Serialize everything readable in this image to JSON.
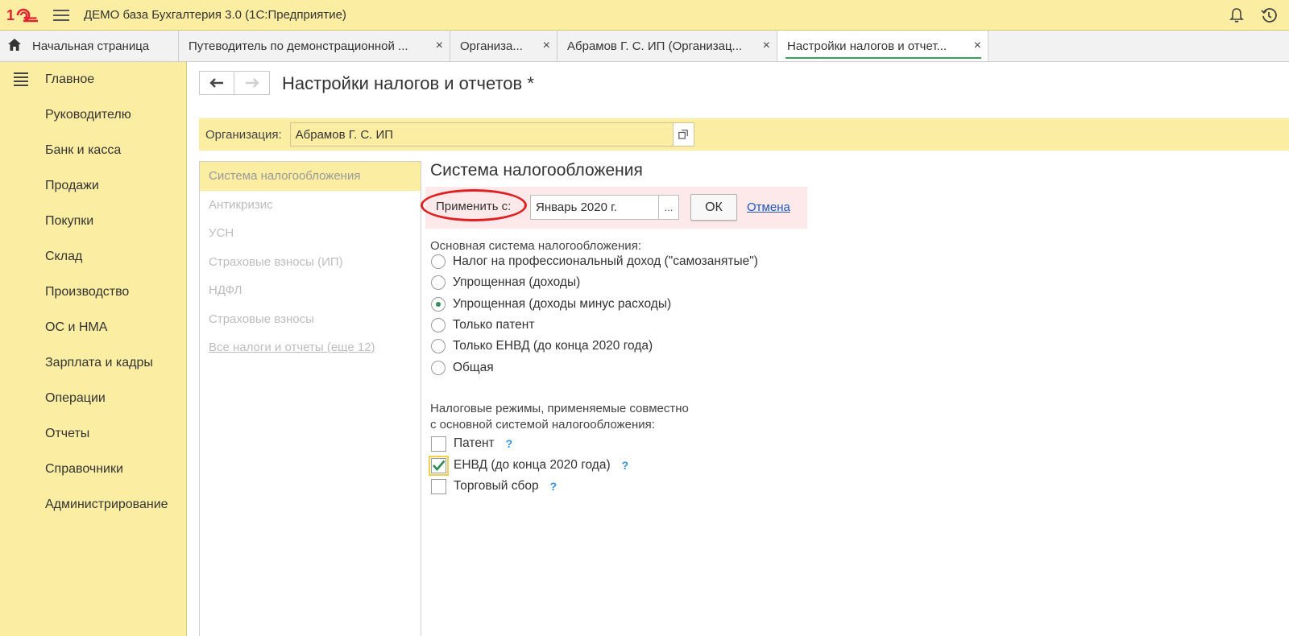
{
  "app": {
    "title": "ДЕМО база Бухгалтерия 3.0  (1С:Предприятие)",
    "logo_text": "1С",
    "brand_color": "#e5202e",
    "accent": "#fbeda2"
  },
  "tabs": [
    {
      "label": "Начальная страница",
      "closable": false
    },
    {
      "label": "Путеводитель по демонстрационной ...",
      "closable": true
    },
    {
      "label": "Организа...",
      "closable": true
    },
    {
      "label": "Абрамов Г. С. ИП (Организац...",
      "closable": true
    },
    {
      "label": "Настройки налогов и отчет...",
      "closable": true,
      "active": true
    }
  ],
  "tab_close_glyph": "×",
  "sidebar": {
    "items": [
      {
        "label": "Главное"
      },
      {
        "label": "Руководителю"
      },
      {
        "label": "Банк и касса"
      },
      {
        "label": "Продажи"
      },
      {
        "label": "Покупки"
      },
      {
        "label": "Склад"
      },
      {
        "label": "Производство"
      },
      {
        "label": "ОС и НМА"
      },
      {
        "label": "Зарплата и кадры"
      },
      {
        "label": "Операции"
      },
      {
        "label": "Отчеты"
      },
      {
        "label": "Справочники"
      },
      {
        "label": "Администрирование"
      }
    ]
  },
  "page": {
    "title": "Настройки налогов и отчетов *",
    "org_label": "Организация:",
    "org_value": "Абрамов Г. С. ИП"
  },
  "leftnav": [
    {
      "label": "Система налогообложения",
      "active": true
    },
    {
      "label": "Антикризис"
    },
    {
      "label": "УСН"
    },
    {
      "label": "Страховые взносы (ИП)"
    },
    {
      "label": "НДФЛ"
    },
    {
      "label": "Страховые взносы"
    },
    {
      "label": "Все налоги и отчеты (еще 12)",
      "link": true
    }
  ],
  "section": {
    "title": "Система налогообложения",
    "apply_label": "Применить с:",
    "apply_date": "Январь 2020 г.",
    "date_button": "...",
    "ok_label": "ОК",
    "cancel_label": "Отмена",
    "main_system_label": "Основная система налогообложения:",
    "radio_options": [
      {
        "label": "Налог на профессиональный доход (\"самозанятые\")",
        "selected": false
      },
      {
        "label": "Упрощенная (доходы)",
        "selected": false
      },
      {
        "label": "Упрощенная (доходы минус расходы)",
        "selected": true
      },
      {
        "label": "Только патент",
        "selected": false
      },
      {
        "label": "Только ЕНВД (до конца 2020 года)",
        "selected": false
      },
      {
        "label": "Общая",
        "selected": false
      }
    ],
    "regimes_label_line1": "Налоговые режимы, применяемые совместно",
    "regimes_label_line2": "с основной системой налогообложения:",
    "checkboxes": [
      {
        "label": "Патент",
        "checked": false,
        "help": "?"
      },
      {
        "label": "ЕНВД (до конца 2020 года)",
        "checked": true,
        "help": "?"
      },
      {
        "label": "Торговый сбор",
        "checked": false,
        "help": "?"
      }
    ]
  }
}
